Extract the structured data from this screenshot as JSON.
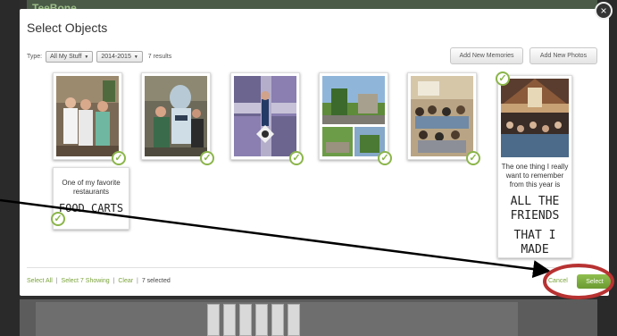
{
  "modal": {
    "title": "Select Objects",
    "close_glyph": "×"
  },
  "filters": {
    "type_label": "Type:",
    "type_value": "All My Stuff",
    "year_value": "2014-2015",
    "results": "7 results"
  },
  "buttons": {
    "add_memories": "Add New Memories",
    "add_photos": "Add New Photos"
  },
  "items": {
    "note1": {
      "line1": "One of my favorite",
      "line2": "restaurants",
      "line3": "FOOD CARTS"
    },
    "note2": {
      "line1": "The one thing I really",
      "line2": "want to remember",
      "line3": "from this year is",
      "line4": "ALL THE FRIENDS",
      "line5": "THAT I MADE"
    }
  },
  "footer": {
    "select_all": "Select All",
    "select_showing": "Select 7 Showing",
    "clear": "Clear",
    "selected": "7 selected",
    "sep": "|",
    "cancel": "Cancel",
    "select": "Select"
  },
  "background": {
    "app_title": "TeeBone"
  },
  "colors": {
    "accent_green": "#8bb54a",
    "annotation_red": "#c0392b"
  }
}
